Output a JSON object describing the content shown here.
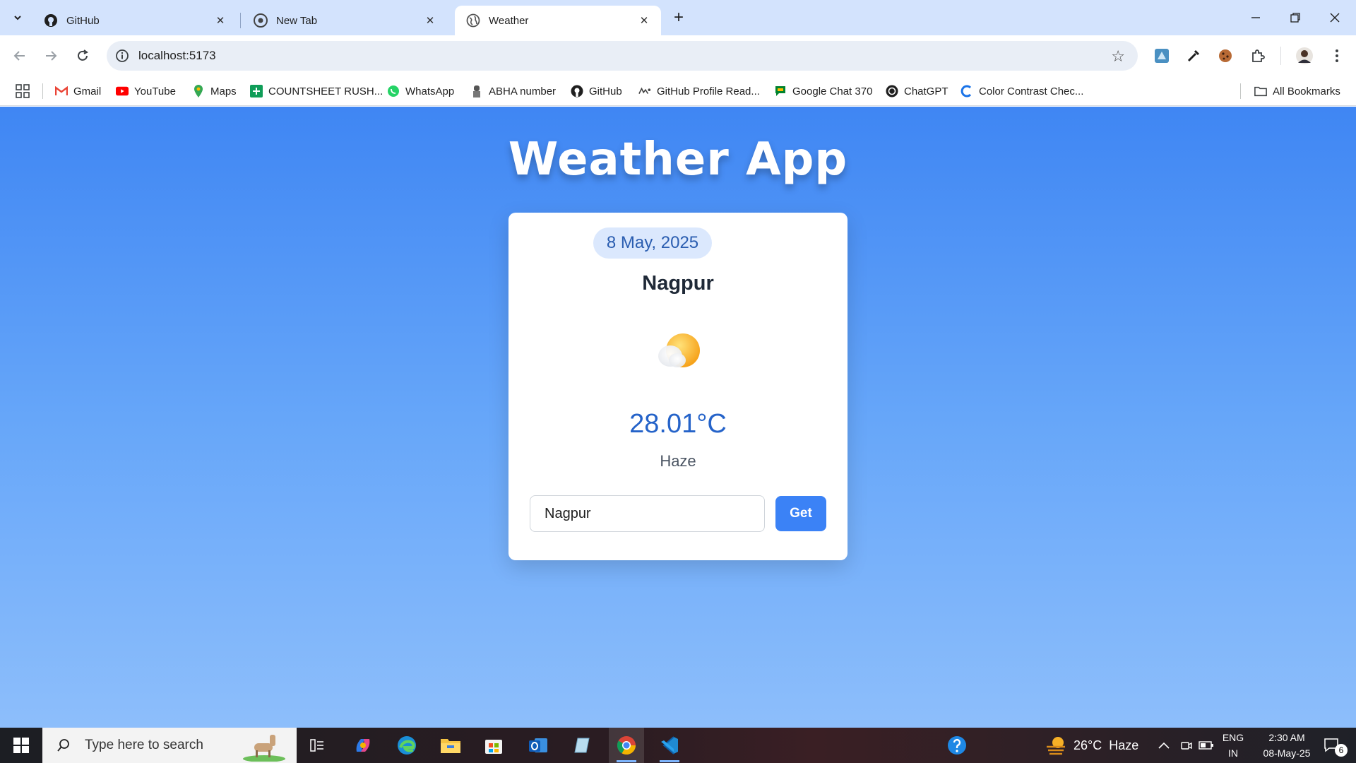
{
  "browser": {
    "tabs": [
      {
        "title": "GitHub",
        "icon": "github-icon",
        "active": false
      },
      {
        "title": "New Tab",
        "icon": "chrome-icon",
        "active": false
      },
      {
        "title": "Weather",
        "icon": "globe-icon",
        "active": true
      }
    ],
    "url": "localhost:5173",
    "bookmarks": [
      {
        "label": "Gmail",
        "icon": "gmail-icon"
      },
      {
        "label": "YouTube",
        "icon": "youtube-icon"
      },
      {
        "label": "Maps",
        "icon": "maps-icon"
      },
      {
        "label": "COUNTSHEET RUSH...",
        "icon": "sheets-icon"
      },
      {
        "label": "WhatsApp",
        "icon": "whatsapp-icon"
      },
      {
        "label": "ABHA number",
        "icon": "emblem-icon"
      },
      {
        "label": "GitHub",
        "icon": "github-icon"
      },
      {
        "label": "GitHub Profile Read...",
        "icon": "readme-icon"
      },
      {
        "label": "Google Chat 370",
        "icon": "google-chat-icon"
      },
      {
        "label": "ChatGPT",
        "icon": "chatgpt-icon"
      },
      {
        "label": "Color Contrast Chec...",
        "icon": "contrast-icon"
      }
    ],
    "all_bookmarks": "All Bookmarks"
  },
  "app": {
    "title": "Weather App",
    "date": "8 May, 2025",
    "city": "Nagpur",
    "weather_icon": "partly-cloudy-icon",
    "temperature": "28.01°C",
    "description": "Haze",
    "input_value": "Nagpur",
    "button_label": "Get",
    "colors": {
      "accent": "#3b82f6",
      "background_top": "#3f86f3",
      "background_bottom": "#8dbefb",
      "temperature": "#2563c9"
    }
  },
  "taskbar": {
    "search_placeholder": "Type here to search",
    "weather_temp": "26°C",
    "weather_desc": "Haze",
    "language": "ENG",
    "region": "IN",
    "time": "2:30 AM",
    "date": "08-May-25",
    "notification_count": "6"
  }
}
